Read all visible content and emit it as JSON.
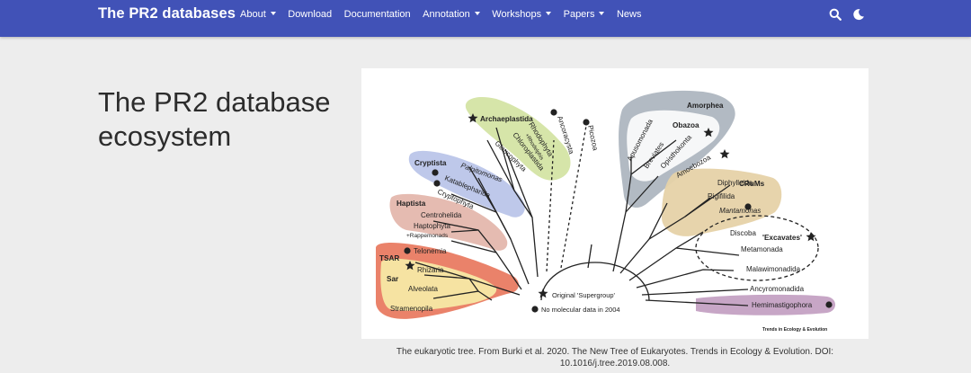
{
  "navbar": {
    "brand": "The PR2 databases",
    "items": [
      {
        "label": "About",
        "dropdown": true
      },
      {
        "label": "Download",
        "dropdown": false
      },
      {
        "label": "Documentation",
        "dropdown": false
      },
      {
        "label": "Annotation",
        "dropdown": true
      },
      {
        "label": "Workshops",
        "dropdown": true
      },
      {
        "label": "Papers",
        "dropdown": true
      },
      {
        "label": "News",
        "dropdown": false
      }
    ],
    "icons": [
      "search-icon",
      "moon-icon"
    ],
    "bg_color": "#4152b7"
  },
  "page": {
    "title": "The PR2 database ecosystem",
    "caption": "The eukaryotic tree. From Burki et al. 2020. The New Tree of Eukaryotes. Trends in Ecology & Evolution. DOI: 10.1016/j.tree.2019.08.008."
  },
  "figure": {
    "groups": {
      "archaeplastida": "Archaeplastida",
      "cryptista": "Cryptista",
      "haptista": "Haptista",
      "tsar": "TSAR",
      "sar": "Sar",
      "amorphea": "Amorphea",
      "obazoa": "Obazoa",
      "crums": "CRuMs",
      "excavates": "'Excavates'"
    },
    "taxa": {
      "rhodophyta": "Rhodophyta",
      "rhodelphis": "+Rhodelphis",
      "chloroplastida": "Chloroplastida",
      "glaucophyta": "Glaucophyta",
      "ancoracysta": "Ancoracysta",
      "picozoa": "Picozoa",
      "palpitomonas": "Palpitomonas",
      "katablepharida": "Katablepharida",
      "cryptophyta": "Cryptophyta",
      "centrohelida": "Centrohelida",
      "haptophyta": "Haptophyta",
      "rappemonads": "+Rappemonads",
      "telonemia": "Telonemia",
      "rhizaria": "Rhizaria",
      "alveolata": "Alveolata",
      "stramenopila": "Stramenopila",
      "apusomonada": "Apusomonada",
      "breviates": "Breviates",
      "opisthokonta": "Opisthokonta",
      "amoebozoa": "Amoebozoa",
      "diphyllatea": "Diphylleida",
      "rigifilida": "Rigifilida",
      "mantamonas": "Mantamonas",
      "discoba": "Discoba",
      "metamonada": "Metamonada",
      "malawimonadida": "Malawimonadida",
      "ancyromonadida": "Ancyromonadida",
      "hemimastigophora": "Hemimastigophora"
    },
    "legend": {
      "star": "Original 'Supergroup'",
      "dot": "No molecular data in 2004"
    },
    "credit": "Trends in Ecology & Evolution"
  }
}
